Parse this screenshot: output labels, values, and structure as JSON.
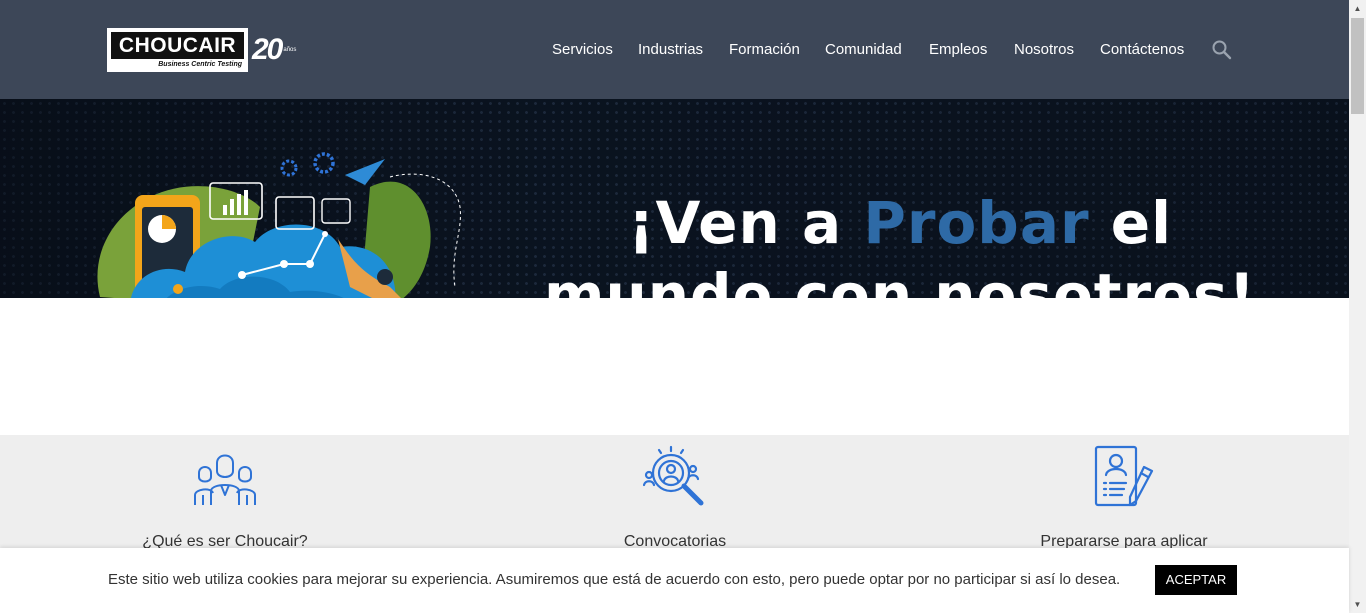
{
  "brand": {
    "logo_text": "CHOUCAIR",
    "logo_tagline": "Business Centric Testing",
    "anniversary": "20",
    "anniversary_sub": "años"
  },
  "nav": {
    "items": [
      {
        "label": "Servicios"
      },
      {
        "label": "Industrias"
      },
      {
        "label": "Formación"
      },
      {
        "label": "Comunidad"
      },
      {
        "label": "Empleos"
      },
      {
        "label": "Nosotros"
      },
      {
        "label": "Contáctenos"
      }
    ],
    "search_icon": "search-icon"
  },
  "hero": {
    "line1_pre": "¡Ven a ",
    "line1_accent": "Probar",
    "line1_post": " el",
    "line2": "mundo con nosotros!",
    "accent_color": "#2e6aa6",
    "illustration": "cloud-testing-illustration"
  },
  "features": [
    {
      "title": "¿Qué es ser Choucair?",
      "icon": "team-icon"
    },
    {
      "title": "Convocatorias",
      "icon": "search-candidate-icon"
    },
    {
      "title": "Prepararse para aplicar",
      "icon": "resume-edit-icon"
    }
  ],
  "cookie": {
    "message": "Este sitio web utiliza cookies para mejorar su experiencia. Asumiremos que está de acuerdo con esto, pero puede optar por no participar si así lo desea.",
    "accept_label": "ACEPTAR"
  },
  "colors": {
    "header_bg": "#3d4758",
    "hero_bg": "#0b1421",
    "icon_blue": "#2f73d6",
    "features_bg": "#eeeeee"
  }
}
